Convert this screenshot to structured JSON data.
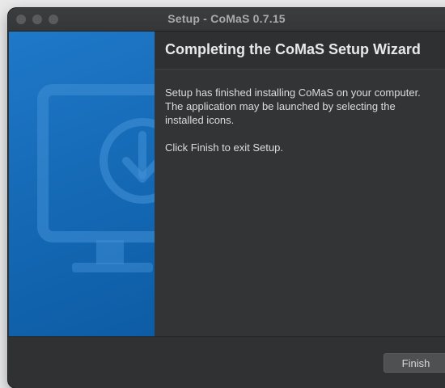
{
  "window": {
    "title": "Setup - CoMaS 0.7.15"
  },
  "sidebar": {
    "illustration_icon": "monitor-download-icon",
    "accent_color": "#1a72c2"
  },
  "content": {
    "heading": "Completing the CoMaS Setup Wizard",
    "paragraphs": [
      "Setup has finished installing CoMaS on your computer. The application may be launched by selecting the installed icons.",
      "Click Finish to exit Setup."
    ]
  },
  "footer": {
    "finish_label": "Finish"
  }
}
